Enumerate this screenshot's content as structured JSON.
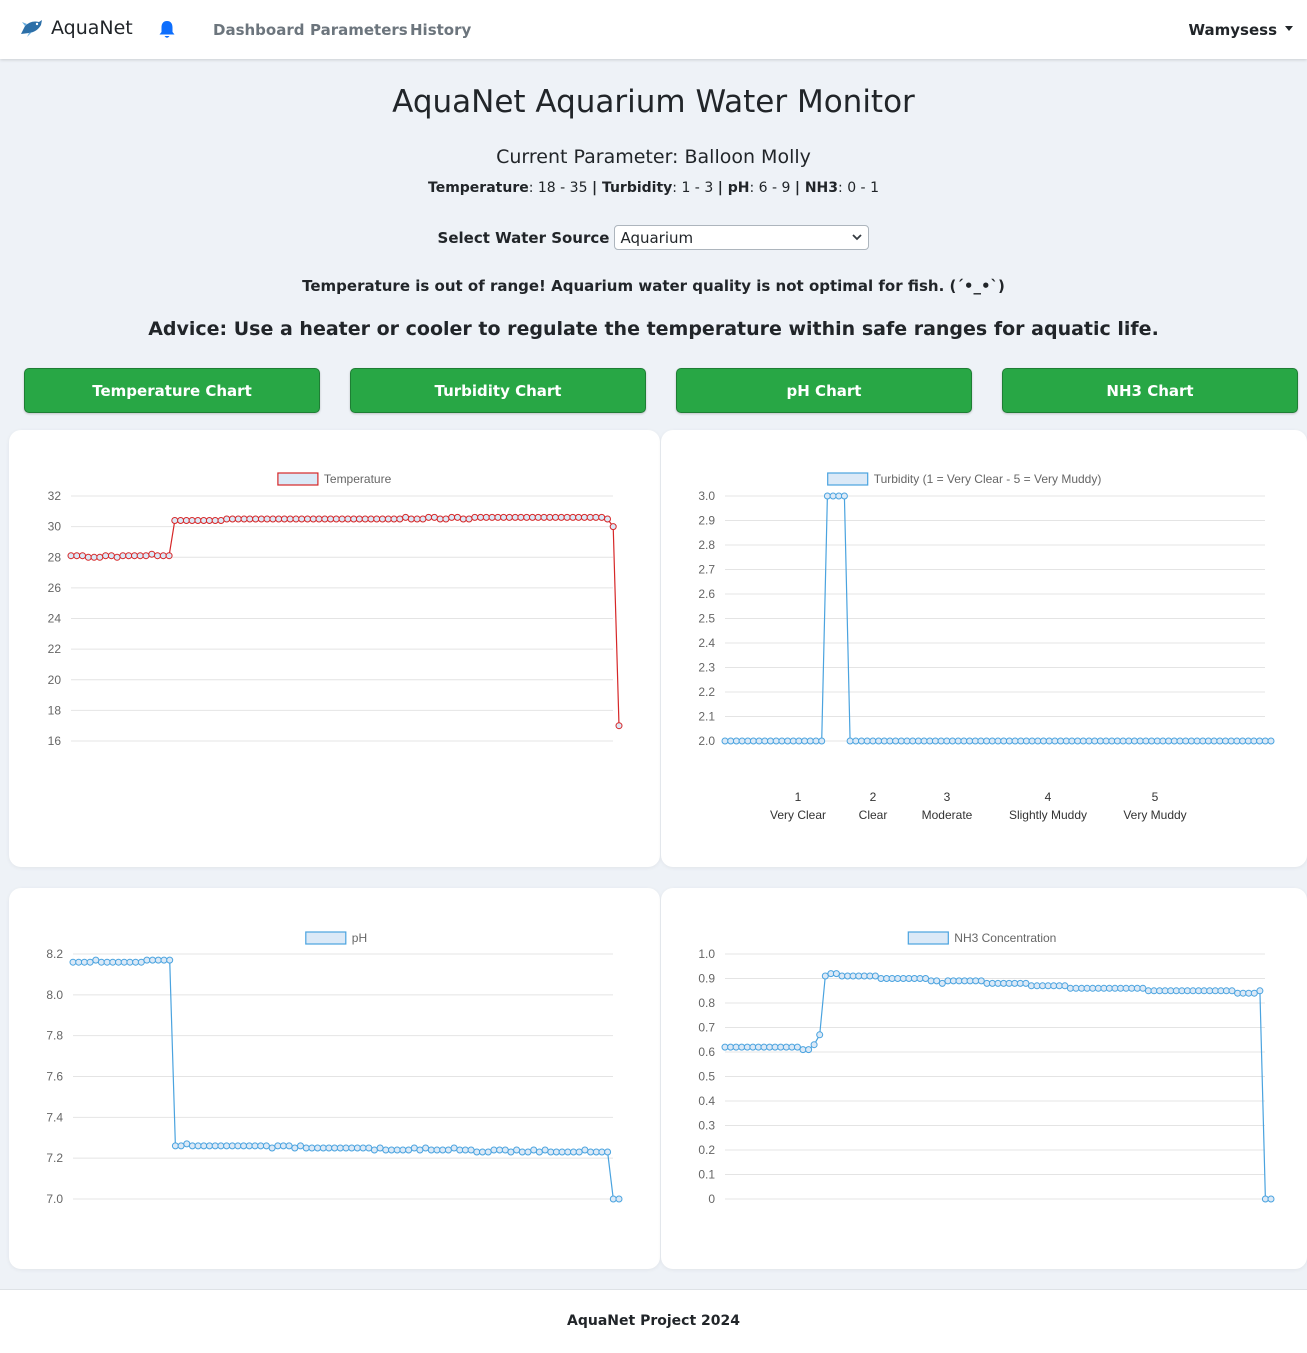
{
  "nav": {
    "brand": "AquaNet",
    "links": [
      "Dashboard",
      "Parameters",
      "History"
    ],
    "user": "Wamysess"
  },
  "header": {
    "title": "AquaNet Aquarium Water Monitor",
    "current_parameter": "Current Parameter: Balloon Molly",
    "ranges": [
      {
        "name": "Temperature",
        "range": "18 - 35"
      },
      {
        "name": "Turbidity",
        "range": "1 - 3"
      },
      {
        "name": "pH",
        "range": "6 - 9"
      },
      {
        "name": "NH3",
        "range": "0 - 1"
      }
    ]
  },
  "source": {
    "label": "Select Water Source",
    "value": "Aquarium"
  },
  "alert": {
    "warning": "Temperature is out of range! Aquarium water quality is not optimal for fish. (´•_•`)",
    "advice": "Advice: Use a heater or cooler to regulate the temperature within safe ranges for aquatic life."
  },
  "buttons": [
    "Temperature Chart",
    "Turbidity Chart",
    "pH Chart",
    "NH3 Chart"
  ],
  "footer": "AquaNet Project 2024",
  "colors": {
    "accent_green": "#28a745",
    "temperature_line": "#d62728",
    "series_blue": "#4aa3df",
    "bell": "#0d6efd"
  },
  "chart_data": [
    {
      "type": "line",
      "legend": "Temperature",
      "ylim": [
        16,
        32
      ],
      "yticks": [
        "32",
        "30",
        "28",
        "26",
        "24",
        "22",
        "20",
        "18",
        "16"
      ],
      "color": "#d62728",
      "values": [
        28.1,
        28.1,
        28.1,
        28.0,
        28.0,
        28.0,
        28.1,
        28.1,
        28.0,
        28.1,
        28.1,
        28.1,
        28.1,
        28.1,
        28.2,
        28.1,
        28.1,
        28.1,
        30.4,
        30.4,
        30.4,
        30.4,
        30.4,
        30.4,
        30.4,
        30.4,
        30.4,
        30.5,
        30.5,
        30.5,
        30.5,
        30.5,
        30.5,
        30.5,
        30.5,
        30.5,
        30.5,
        30.5,
        30.5,
        30.5,
        30.5,
        30.5,
        30.5,
        30.5,
        30.5,
        30.5,
        30.5,
        30.5,
        30.5,
        30.5,
        30.5,
        30.5,
        30.5,
        30.5,
        30.5,
        30.5,
        30.5,
        30.5,
        30.6,
        30.5,
        30.5,
        30.5,
        30.6,
        30.6,
        30.5,
        30.5,
        30.6,
        30.6,
        30.5,
        30.5,
        30.6,
        30.6,
        30.6,
        30.6,
        30.6,
        30.6,
        30.6,
        30.6,
        30.6,
        30.6,
        30.6,
        30.6,
        30.6,
        30.6,
        30.6,
        30.6,
        30.6,
        30.6,
        30.6,
        30.6,
        30.6,
        30.6,
        30.6,
        30.5,
        30.0,
        17.0
      ]
    },
    {
      "type": "line",
      "legend": "Turbidity (1 = Very Clear - 5 = Very Muddy)",
      "ylim": [
        2.0,
        3.0
      ],
      "yticks": [
        "3.0",
        "2.9",
        "2.8",
        "2.7",
        "2.6",
        "2.5",
        "2.4",
        "2.3",
        "2.2",
        "2.1",
        "2.0"
      ],
      "color": "#4aa3df",
      "values": [
        2,
        2,
        2,
        2,
        2,
        2,
        2,
        2,
        2,
        2,
        2,
        2,
        2,
        2,
        2,
        2,
        2,
        2,
        3,
        3,
        3,
        3,
        2,
        2,
        2,
        2,
        2,
        2,
        2,
        2,
        2,
        2,
        2,
        2,
        2,
        2,
        2,
        2,
        2,
        2,
        2,
        2,
        2,
        2,
        2,
        2,
        2,
        2,
        2,
        2,
        2,
        2,
        2,
        2,
        2,
        2,
        2,
        2,
        2,
        2,
        2,
        2,
        2,
        2,
        2,
        2,
        2,
        2,
        2,
        2,
        2,
        2,
        2,
        2,
        2,
        2,
        2,
        2,
        2,
        2,
        2,
        2,
        2,
        2,
        2,
        2,
        2,
        2,
        2,
        2,
        2,
        2,
        2,
        2,
        2,
        2,
        2
      ],
      "scale_key": [
        {
          "num": "1",
          "label": "Very Clear"
        },
        {
          "num": "2",
          "label": "Clear"
        },
        {
          "num": "3",
          "label": "Moderate"
        },
        {
          "num": "4",
          "label": "Slightly Muddy"
        },
        {
          "num": "5",
          "label": "Very Muddy"
        }
      ]
    },
    {
      "type": "line",
      "legend": "pH",
      "ylim": [
        7.0,
        8.2
      ],
      "yticks": [
        "8.2",
        "8.0",
        "7.8",
        "7.6",
        "7.4",
        "7.2",
        "7.0"
      ],
      "color": "#4aa3df",
      "values": [
        8.16,
        8.16,
        8.16,
        8.16,
        8.17,
        8.16,
        8.16,
        8.16,
        8.16,
        8.16,
        8.16,
        8.16,
        8.16,
        8.17,
        8.17,
        8.17,
        8.17,
        8.17,
        7.26,
        7.26,
        7.27,
        7.26,
        7.26,
        7.26,
        7.26,
        7.26,
        7.26,
        7.26,
        7.26,
        7.26,
        7.26,
        7.26,
        7.26,
        7.26,
        7.26,
        7.25,
        7.26,
        7.26,
        7.26,
        7.25,
        7.26,
        7.25,
        7.25,
        7.25,
        7.25,
        7.25,
        7.25,
        7.25,
        7.25,
        7.25,
        7.25,
        7.25,
        7.25,
        7.24,
        7.25,
        7.24,
        7.24,
        7.24,
        7.24,
        7.24,
        7.25,
        7.24,
        7.25,
        7.24,
        7.24,
        7.24,
        7.24,
        7.25,
        7.24,
        7.24,
        7.24,
        7.23,
        7.23,
        7.23,
        7.24,
        7.24,
        7.24,
        7.23,
        7.24,
        7.23,
        7.23,
        7.24,
        7.23,
        7.24,
        7.23,
        7.23,
        7.23,
        7.23,
        7.23,
        7.23,
        7.24,
        7.23,
        7.23,
        7.23,
        7.23,
        7.0,
        7.0
      ]
    },
    {
      "type": "line",
      "legend": "NH3 Concentration",
      "ylim": [
        0,
        1.0
      ],
      "yticks": [
        "1.0",
        "0.9",
        "0.8",
        "0.7",
        "0.6",
        "0.5",
        "0.4",
        "0.3",
        "0.2",
        "0.1",
        "0"
      ],
      "color": "#4aa3df",
      "values": [
        0.62,
        0.62,
        0.62,
        0.62,
        0.62,
        0.62,
        0.62,
        0.62,
        0.62,
        0.62,
        0.62,
        0.62,
        0.62,
        0.62,
        0.61,
        0.61,
        0.63,
        0.67,
        0.91,
        0.92,
        0.92,
        0.91,
        0.91,
        0.91,
        0.91,
        0.91,
        0.91,
        0.91,
        0.9,
        0.9,
        0.9,
        0.9,
        0.9,
        0.9,
        0.9,
        0.9,
        0.9,
        0.89,
        0.89,
        0.88,
        0.89,
        0.89,
        0.89,
        0.89,
        0.89,
        0.89,
        0.89,
        0.88,
        0.88,
        0.88,
        0.88,
        0.88,
        0.88,
        0.88,
        0.88,
        0.87,
        0.87,
        0.87,
        0.87,
        0.87,
        0.87,
        0.87,
        0.86,
        0.86,
        0.86,
        0.86,
        0.86,
        0.86,
        0.86,
        0.86,
        0.86,
        0.86,
        0.86,
        0.86,
        0.86,
        0.86,
        0.85,
        0.85,
        0.85,
        0.85,
        0.85,
        0.85,
        0.85,
        0.85,
        0.85,
        0.85,
        0.85,
        0.85,
        0.85,
        0.85,
        0.85,
        0.85,
        0.84,
        0.84,
        0.84,
        0.84,
        0.85,
        0,
        0
      ]
    }
  ]
}
